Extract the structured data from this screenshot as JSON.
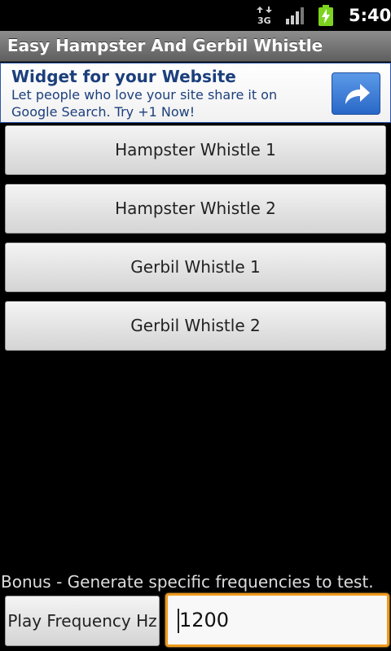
{
  "status_bar": {
    "network_label": "3G",
    "time": "5:40",
    "icons": [
      "data-arrows-icon",
      "signal-strength-icon",
      "battery-charging-icon"
    ]
  },
  "title_bar": {
    "title": "Easy Hampster And Gerbil Whistle"
  },
  "ad": {
    "title": "Widget for your Website",
    "body": "Let people who love your site share it on Google Search. Try +1 Now!",
    "share_icon": "share-arrow-icon"
  },
  "whistles": [
    {
      "label": "Hampster Whistle 1"
    },
    {
      "label": "Hampster Whistle 2"
    },
    {
      "label": "Gerbil Whistle 1"
    },
    {
      "label": "Gerbil Whistle 2"
    }
  ],
  "bonus": {
    "label": "Bonus - Generate specific frequencies to test.",
    "play_button": "Play Frequency Hz",
    "frequency_value": "1200"
  },
  "colors": {
    "background": "#000000",
    "input_focus": "#f09a1c",
    "ad_text": "#1c3f7c",
    "share_button": "#2a68c8",
    "battery": "#7ed321"
  }
}
